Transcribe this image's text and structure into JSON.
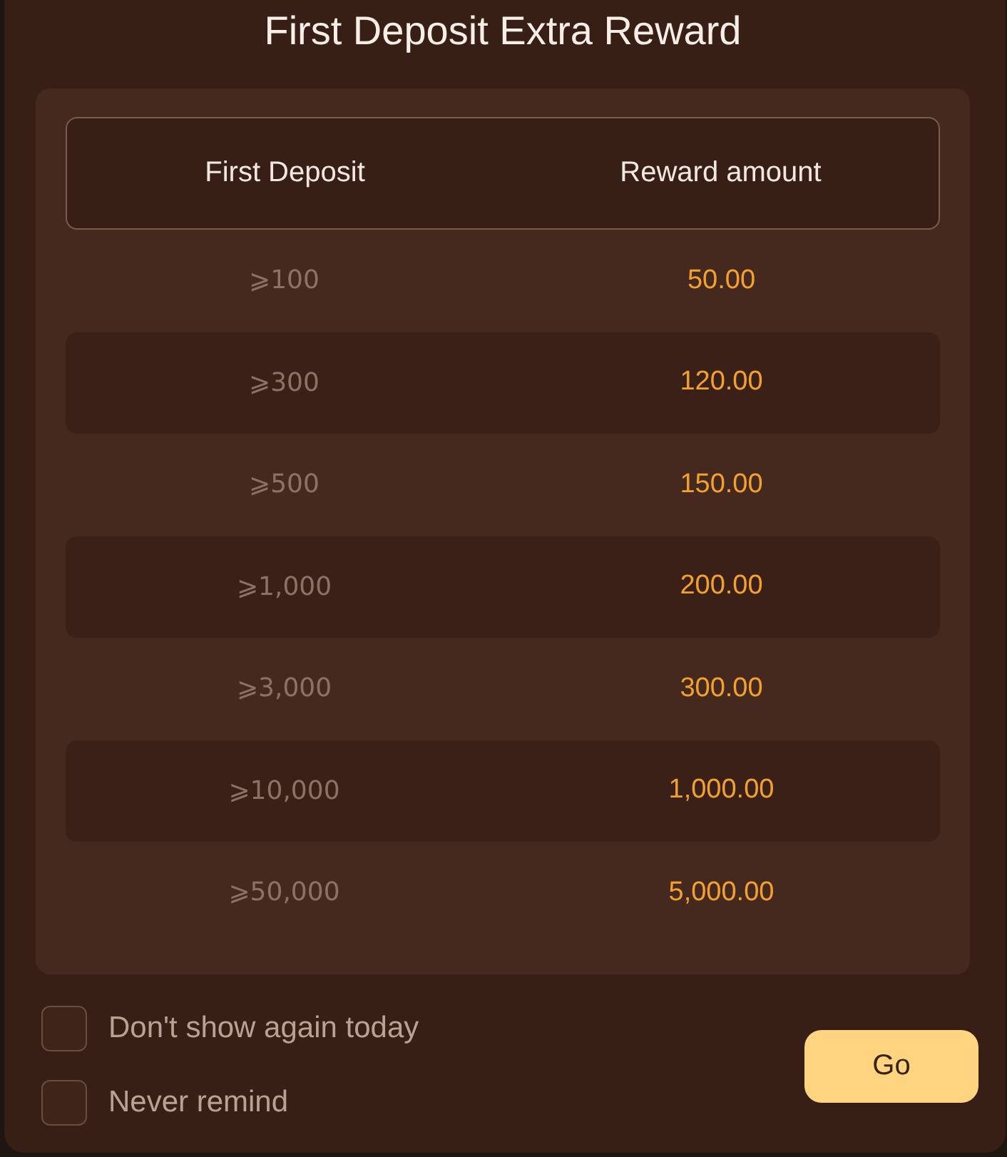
{
  "dialog": {
    "title": "First Deposit Extra Reward"
  },
  "table": {
    "columns": [
      "First Deposit",
      "Reward amount"
    ],
    "rows": [
      {
        "first_deposit": "⩾100",
        "reward_amount": "50.00"
      },
      {
        "first_deposit": "⩾300",
        "reward_amount": "120.00"
      },
      {
        "first_deposit": "⩾500",
        "reward_amount": "150.00"
      },
      {
        "first_deposit": "⩾1,000",
        "reward_amount": "200.00"
      },
      {
        "first_deposit": "⩾3,000",
        "reward_amount": "300.00"
      },
      {
        "first_deposit": "⩾10,000",
        "reward_amount": "1,000.00"
      },
      {
        "first_deposit": "⩾50,000",
        "reward_amount": "5,000.00"
      }
    ]
  },
  "options": [
    {
      "label": "Don't show again today",
      "checked": false
    },
    {
      "label": "Never remind",
      "checked": false
    }
  ],
  "buttons": [
    {
      "label": "Go",
      "kind": "primary"
    }
  ]
}
